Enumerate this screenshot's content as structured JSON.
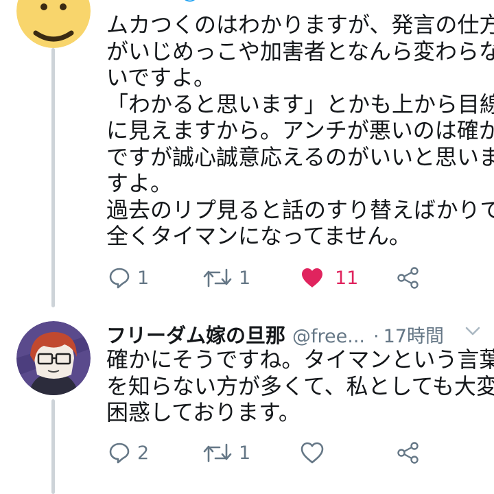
{
  "tweet1": {
    "header_partial": "@",
    "body_lines": [
      "ムカつくのはわかりますが、発言の仕方",
      "がいじめっこや加害者となんら変わらな",
      "いですよ。",
      "「わかると思います」とかも上から目線",
      "に見えますから。アンチが悪いのは確か",
      "ですが誠心誠意応えるのがいいと思いま",
      "すよ。",
      "過去のリプ見ると話のすり替えばかりで",
      "全くタイマンになってません。"
    ],
    "actions": {
      "reply_icon": "reply-icon",
      "reply_count": "1",
      "retweet_icon": "retweet-icon",
      "retweet_count": "1",
      "like_icon": "heart-filled-icon",
      "like_count": "11",
      "like_color": "#e0245e",
      "share_icon": "share-icon"
    }
  },
  "tweet2": {
    "display_name": "フリーダム嫁の旦那",
    "handle": "@free...",
    "separator": "·",
    "timestamp": "17時間",
    "body_lines": [
      "確かにそうですね。タイマンという言葉",
      "を知らない方が多くて、私としても大変",
      "困惑しております。"
    ],
    "actions": {
      "reply_icon": "reply-icon",
      "reply_count": "2",
      "retweet_icon": "retweet-icon",
      "retweet_count": "1",
      "like_icon": "heart-outline-icon",
      "like_count": "",
      "share_icon": "share-icon"
    }
  },
  "colors": {
    "text": "#14171a",
    "secondary": "#657786",
    "link": "#1da1f2",
    "like": "#e0245e",
    "thread_line": "#cdd3d8"
  }
}
